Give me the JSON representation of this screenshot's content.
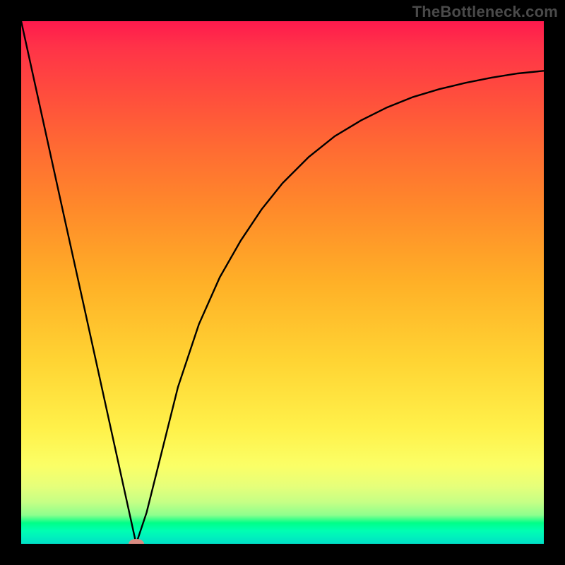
{
  "attribution": "TheBottleneck.com",
  "chart_data": {
    "type": "line",
    "title": "",
    "xlabel": "",
    "ylabel": "",
    "xlim": [
      0,
      100
    ],
    "ylim": [
      0,
      100
    ],
    "grid": false,
    "curve": {
      "description": "Bottleneck percentage vs component strength. V-shaped: drops linearly to ~0 at the optimal point, then rises with diminishing slope toward an asymptote.",
      "x": [
        0,
        4,
        8,
        12,
        16,
        20,
        22,
        24,
        26,
        28,
        30,
        34,
        38,
        42,
        46,
        50,
        55,
        60,
        65,
        70,
        75,
        80,
        85,
        90,
        95,
        100
      ],
      "y": [
        100,
        81.8,
        63.6,
        45.5,
        27.3,
        9.1,
        0,
        6,
        14,
        22,
        30,
        42,
        51,
        58,
        64,
        69,
        74,
        78,
        81,
        83.5,
        85.5,
        87,
        88.2,
        89.2,
        90,
        90.5
      ]
    },
    "marker": {
      "x": 22,
      "y": 0,
      "color": "#d98b82"
    },
    "background_gradient": {
      "direction": "vertical",
      "stops": [
        {
          "pos": 0.0,
          "color": "#ff1a4d"
        },
        {
          "pos": 0.5,
          "color": "#ffb027"
        },
        {
          "pos": 0.78,
          "color": "#fff14a"
        },
        {
          "pos": 0.96,
          "color": "#00ff88"
        },
        {
          "pos": 1.0,
          "color": "#00e0c7"
        }
      ]
    }
  }
}
